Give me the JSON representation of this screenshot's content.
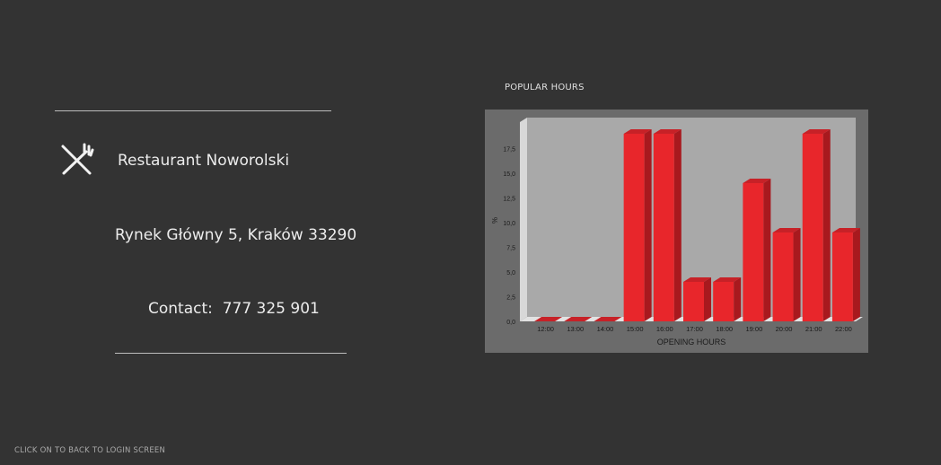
{
  "restaurant": {
    "name": "Restaurant Noworolski",
    "address": "Rynek Główny 5, Kraków 33290",
    "contact_label": "Contact:",
    "phone": "777 325 901",
    "icon": "fork-knife-icon"
  },
  "section": {
    "popular_hours_title": "POPULAR HOURS"
  },
  "footer": {
    "back_link": "CLICK ON TO BACK TO LOGIN SCREEN"
  },
  "colors": {
    "background": "#333333",
    "bar": "#e8262b",
    "bar_top": "#c72127",
    "bar_side": "#a8191e",
    "plot_bg": "#a9a9a9",
    "frame": "#6b6b6b"
  },
  "chart_data": {
    "type": "bar",
    "categories": [
      "12:00",
      "13:00",
      "14:00",
      "15:00",
      "16:00",
      "17:00",
      "18:00",
      "19:00",
      "20:00",
      "21:00",
      "22:00"
    ],
    "values": [
      0,
      0,
      0,
      19,
      19,
      4,
      4,
      14,
      9,
      19,
      9
    ],
    "xlabel": "OPENING HOURS",
    "ylabel": "%",
    "ylim": [
      0,
      20
    ],
    "yticks": [
      "0,0",
      "2,5",
      "5,0",
      "7,5",
      "10,0",
      "12,5",
      "15,0",
      "17,5"
    ],
    "grid": false,
    "legend": "none",
    "style": "3d"
  }
}
